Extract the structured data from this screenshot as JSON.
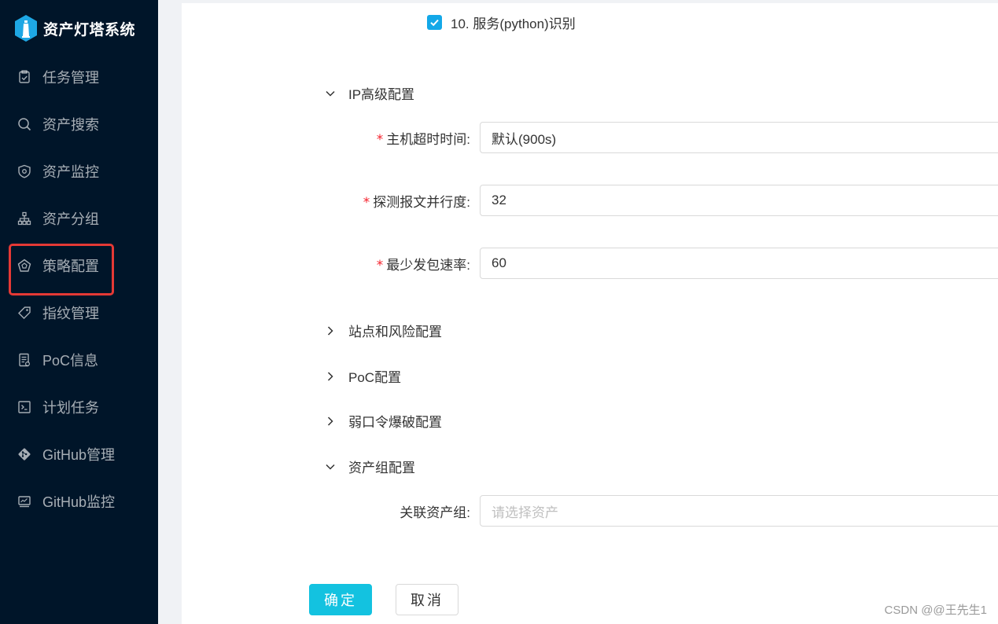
{
  "app": {
    "title": "资产灯塔系统"
  },
  "colors": {
    "sidebar_bg": "#001529",
    "accent": "#13c2e0",
    "required": "#f5222d",
    "highlight_box": "#e53935"
  },
  "sidebar": {
    "items": [
      {
        "label": "任务管理",
        "icon": "task-icon"
      },
      {
        "label": "资产搜索",
        "icon": "search-icon"
      },
      {
        "label": "资产监控",
        "icon": "shield-icon"
      },
      {
        "label": "资产分组",
        "icon": "org-tree-icon"
      },
      {
        "label": "策略配置",
        "icon": "policy-icon",
        "highlighted": true
      },
      {
        "label": "指纹管理",
        "icon": "tag-icon"
      },
      {
        "label": "PoC信息",
        "icon": "doc-icon"
      },
      {
        "label": "计划任务",
        "icon": "terminal-icon"
      },
      {
        "label": "GitHub管理",
        "icon": "git-icon"
      },
      {
        "label": "GitHub监控",
        "icon": "monitor-icon"
      }
    ]
  },
  "form": {
    "service_check": {
      "label": "10. 服务(python)识别",
      "checked": true
    },
    "sections": {
      "ip_advanced": "IP高级配置",
      "site_risk": "站点和风险配置",
      "poc": "PoC配置",
      "weak_pass": "弱口令爆破配置",
      "asset_group": "资产组配置"
    },
    "fields": {
      "host_timeout": {
        "label": "主机超时时间:",
        "value": "默认(900s)"
      },
      "probe_parallel": {
        "label": "探测报文并行度:",
        "value": "32"
      },
      "min_rate": {
        "label": "最少发包速率:",
        "value": "60"
      },
      "asset_group": {
        "label": "关联资产组:",
        "placeholder": "请选择资产"
      }
    },
    "required_mark": "*",
    "buttons": {
      "confirm": "确定",
      "cancel": "取消"
    }
  },
  "watermark": "CSDN @@王先生1"
}
